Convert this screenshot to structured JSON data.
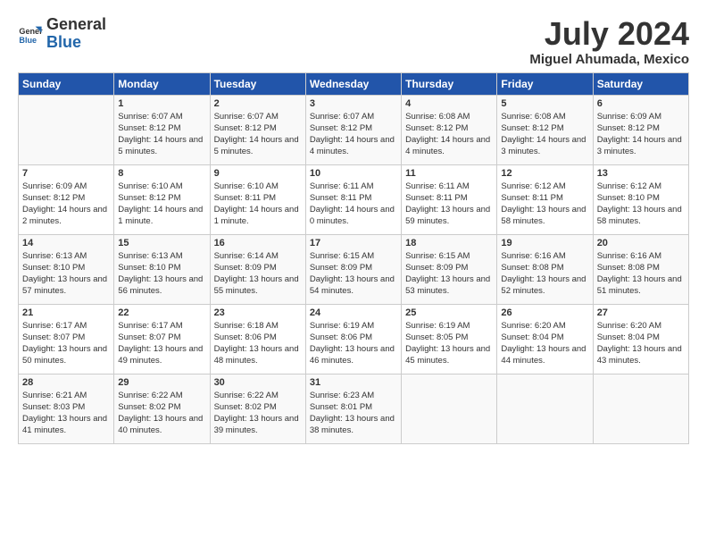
{
  "logo": {
    "text_general": "General",
    "text_blue": "Blue"
  },
  "header": {
    "month": "July 2024",
    "location": "Miguel Ahumada, Mexico"
  },
  "weekdays": [
    "Sunday",
    "Monday",
    "Tuesday",
    "Wednesday",
    "Thursday",
    "Friday",
    "Saturday"
  ],
  "weeks": [
    [
      {
        "day": "",
        "sunrise": "",
        "sunset": "",
        "daylight": ""
      },
      {
        "day": "1",
        "sunrise": "Sunrise: 6:07 AM",
        "sunset": "Sunset: 8:12 PM",
        "daylight": "Daylight: 14 hours and 5 minutes."
      },
      {
        "day": "2",
        "sunrise": "Sunrise: 6:07 AM",
        "sunset": "Sunset: 8:12 PM",
        "daylight": "Daylight: 14 hours and 5 minutes."
      },
      {
        "day": "3",
        "sunrise": "Sunrise: 6:07 AM",
        "sunset": "Sunset: 8:12 PM",
        "daylight": "Daylight: 14 hours and 4 minutes."
      },
      {
        "day": "4",
        "sunrise": "Sunrise: 6:08 AM",
        "sunset": "Sunset: 8:12 PM",
        "daylight": "Daylight: 14 hours and 4 minutes."
      },
      {
        "day": "5",
        "sunrise": "Sunrise: 6:08 AM",
        "sunset": "Sunset: 8:12 PM",
        "daylight": "Daylight: 14 hours and 3 minutes."
      },
      {
        "day": "6",
        "sunrise": "Sunrise: 6:09 AM",
        "sunset": "Sunset: 8:12 PM",
        "daylight": "Daylight: 14 hours and 3 minutes."
      }
    ],
    [
      {
        "day": "7",
        "sunrise": "Sunrise: 6:09 AM",
        "sunset": "Sunset: 8:12 PM",
        "daylight": "Daylight: 14 hours and 2 minutes."
      },
      {
        "day": "8",
        "sunrise": "Sunrise: 6:10 AM",
        "sunset": "Sunset: 8:12 PM",
        "daylight": "Daylight: 14 hours and 1 minute."
      },
      {
        "day": "9",
        "sunrise": "Sunrise: 6:10 AM",
        "sunset": "Sunset: 8:11 PM",
        "daylight": "Daylight: 14 hours and 1 minute."
      },
      {
        "day": "10",
        "sunrise": "Sunrise: 6:11 AM",
        "sunset": "Sunset: 8:11 PM",
        "daylight": "Daylight: 14 hours and 0 minutes."
      },
      {
        "day": "11",
        "sunrise": "Sunrise: 6:11 AM",
        "sunset": "Sunset: 8:11 PM",
        "daylight": "Daylight: 13 hours and 59 minutes."
      },
      {
        "day": "12",
        "sunrise": "Sunrise: 6:12 AM",
        "sunset": "Sunset: 8:11 PM",
        "daylight": "Daylight: 13 hours and 58 minutes."
      },
      {
        "day": "13",
        "sunrise": "Sunrise: 6:12 AM",
        "sunset": "Sunset: 8:10 PM",
        "daylight": "Daylight: 13 hours and 58 minutes."
      }
    ],
    [
      {
        "day": "14",
        "sunrise": "Sunrise: 6:13 AM",
        "sunset": "Sunset: 8:10 PM",
        "daylight": "Daylight: 13 hours and 57 minutes."
      },
      {
        "day": "15",
        "sunrise": "Sunrise: 6:13 AM",
        "sunset": "Sunset: 8:10 PM",
        "daylight": "Daylight: 13 hours and 56 minutes."
      },
      {
        "day": "16",
        "sunrise": "Sunrise: 6:14 AM",
        "sunset": "Sunset: 8:09 PM",
        "daylight": "Daylight: 13 hours and 55 minutes."
      },
      {
        "day": "17",
        "sunrise": "Sunrise: 6:15 AM",
        "sunset": "Sunset: 8:09 PM",
        "daylight": "Daylight: 13 hours and 54 minutes."
      },
      {
        "day": "18",
        "sunrise": "Sunrise: 6:15 AM",
        "sunset": "Sunset: 8:09 PM",
        "daylight": "Daylight: 13 hours and 53 minutes."
      },
      {
        "day": "19",
        "sunrise": "Sunrise: 6:16 AM",
        "sunset": "Sunset: 8:08 PM",
        "daylight": "Daylight: 13 hours and 52 minutes."
      },
      {
        "day": "20",
        "sunrise": "Sunrise: 6:16 AM",
        "sunset": "Sunset: 8:08 PM",
        "daylight": "Daylight: 13 hours and 51 minutes."
      }
    ],
    [
      {
        "day": "21",
        "sunrise": "Sunrise: 6:17 AM",
        "sunset": "Sunset: 8:07 PM",
        "daylight": "Daylight: 13 hours and 50 minutes."
      },
      {
        "day": "22",
        "sunrise": "Sunrise: 6:17 AM",
        "sunset": "Sunset: 8:07 PM",
        "daylight": "Daylight: 13 hours and 49 minutes."
      },
      {
        "day": "23",
        "sunrise": "Sunrise: 6:18 AM",
        "sunset": "Sunset: 8:06 PM",
        "daylight": "Daylight: 13 hours and 48 minutes."
      },
      {
        "day": "24",
        "sunrise": "Sunrise: 6:19 AM",
        "sunset": "Sunset: 8:06 PM",
        "daylight": "Daylight: 13 hours and 46 minutes."
      },
      {
        "day": "25",
        "sunrise": "Sunrise: 6:19 AM",
        "sunset": "Sunset: 8:05 PM",
        "daylight": "Daylight: 13 hours and 45 minutes."
      },
      {
        "day": "26",
        "sunrise": "Sunrise: 6:20 AM",
        "sunset": "Sunset: 8:04 PM",
        "daylight": "Daylight: 13 hours and 44 minutes."
      },
      {
        "day": "27",
        "sunrise": "Sunrise: 6:20 AM",
        "sunset": "Sunset: 8:04 PM",
        "daylight": "Daylight: 13 hours and 43 minutes."
      }
    ],
    [
      {
        "day": "28",
        "sunrise": "Sunrise: 6:21 AM",
        "sunset": "Sunset: 8:03 PM",
        "daylight": "Daylight: 13 hours and 41 minutes."
      },
      {
        "day": "29",
        "sunrise": "Sunrise: 6:22 AM",
        "sunset": "Sunset: 8:02 PM",
        "daylight": "Daylight: 13 hours and 40 minutes."
      },
      {
        "day": "30",
        "sunrise": "Sunrise: 6:22 AM",
        "sunset": "Sunset: 8:02 PM",
        "daylight": "Daylight: 13 hours and 39 minutes."
      },
      {
        "day": "31",
        "sunrise": "Sunrise: 6:23 AM",
        "sunset": "Sunset: 8:01 PM",
        "daylight": "Daylight: 13 hours and 38 minutes."
      },
      {
        "day": "",
        "sunrise": "",
        "sunset": "",
        "daylight": ""
      },
      {
        "day": "",
        "sunrise": "",
        "sunset": "",
        "daylight": ""
      },
      {
        "day": "",
        "sunrise": "",
        "sunset": "",
        "daylight": ""
      }
    ]
  ]
}
